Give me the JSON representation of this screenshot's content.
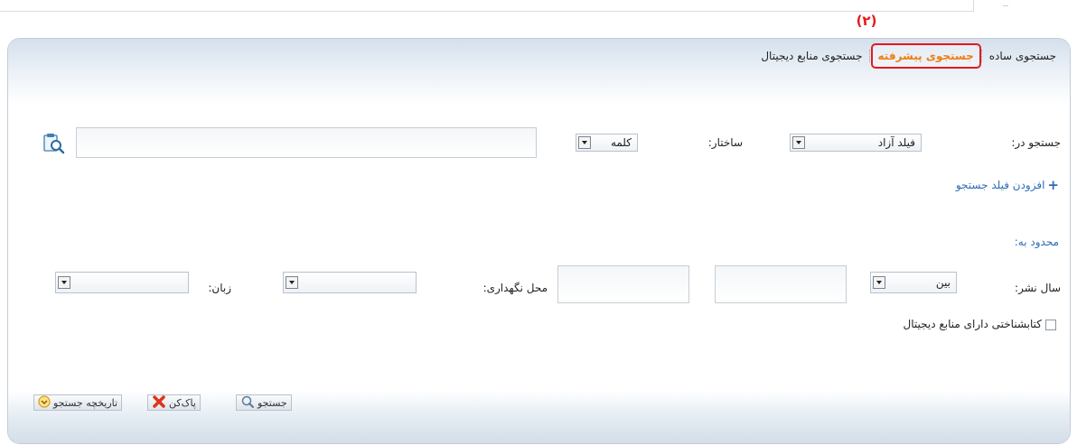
{
  "annotation": "(۲)",
  "tabs": {
    "simple": "جستجوی ساده",
    "advanced": "جستجوی پیشرفته",
    "digital": "جستجوی منابع دیجیتال"
  },
  "search": {
    "search_in_label": "جستجو در:",
    "search_in_value": "فیلد آزاد",
    "structure_label": "ساختار:",
    "structure_value": "کلمه",
    "query_value": "",
    "add_field_label": "افزودن فیلد جستجو"
  },
  "limits": {
    "limited_to_label": "محدود به:",
    "pub_year_label": "سال نشر:",
    "pub_year_mode": "بین",
    "year_from": "",
    "year_to": "",
    "location_label": "محل نگهداری:",
    "location_value": "",
    "language_label": "زبان:",
    "language_value": "",
    "digital_only_label": "کتابشناختی دارای منابع دیجیتال",
    "digital_only_checked": false
  },
  "footer": {
    "search_button": "جستجو",
    "clear_button": "پاک‌کن",
    "history_button": "تاریخچه جستجو"
  },
  "colors": {
    "highlight": "#e4191d",
    "active_tab_text": "#f07c10",
    "link_blue": "#2d6db8"
  }
}
